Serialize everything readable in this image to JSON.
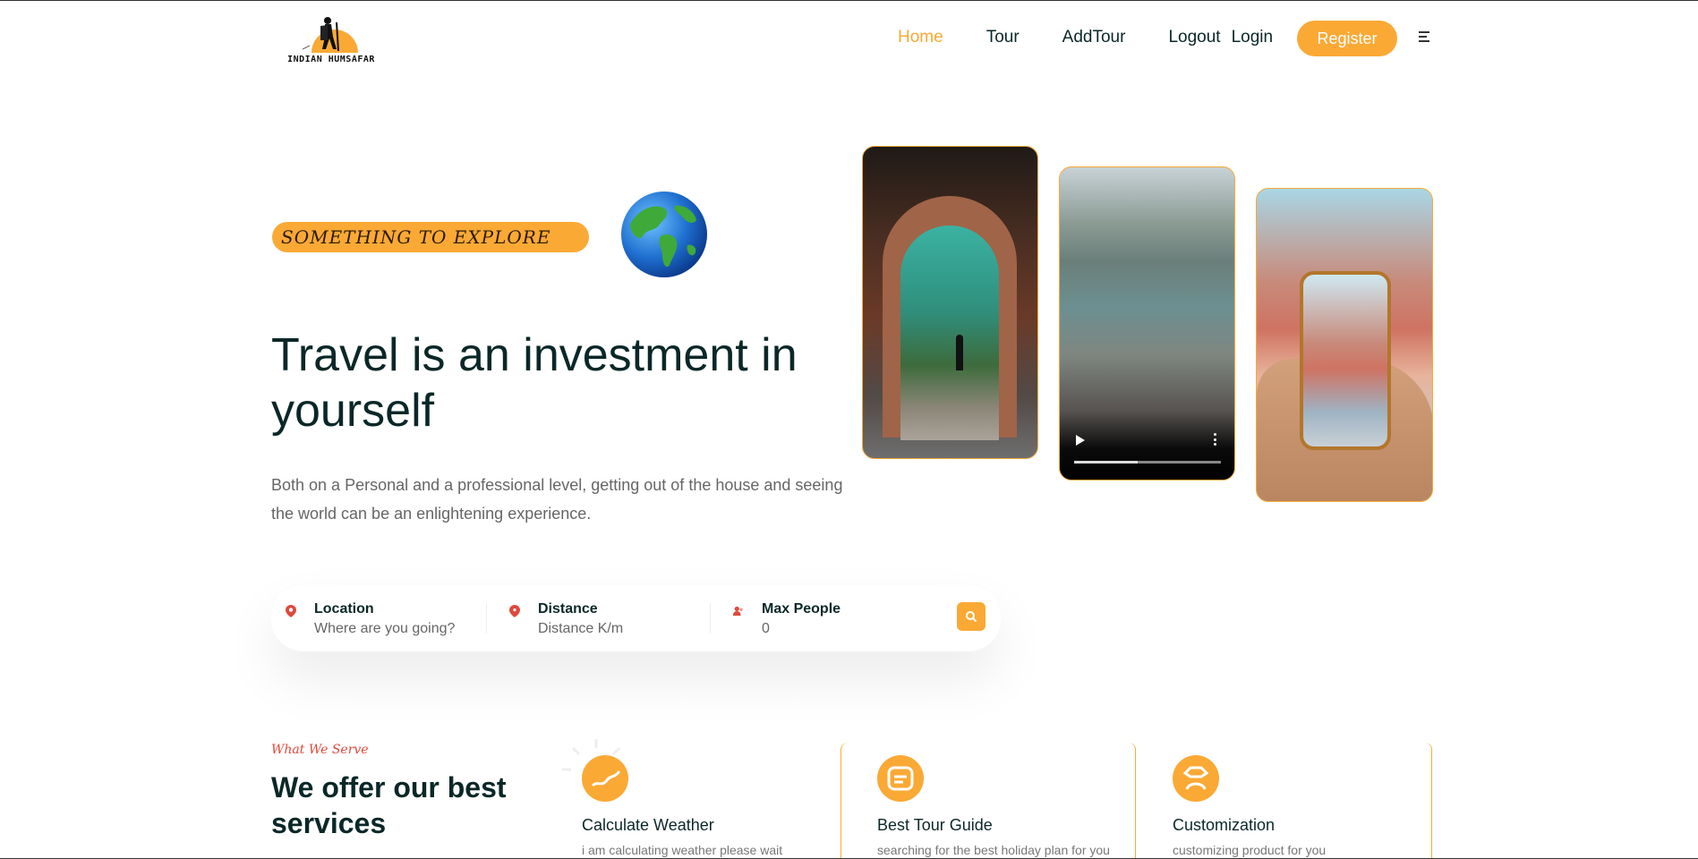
{
  "brand": {
    "logo_text": "INDIAN HUMSAFAR"
  },
  "nav": {
    "items": [
      "Home",
      "Tour",
      "AddTour",
      "Logout",
      "Login"
    ],
    "active": "Home",
    "register_label": "Register"
  },
  "hero": {
    "subtitle": "SOMETHING TO EXPLORE",
    "title": "Travel is an investment in yourself",
    "description": "Both on a Personal and a professional level, getting out of the house and seeing the world can be an enlightening experience."
  },
  "gallery": {
    "video_progress_percent": 43
  },
  "search": {
    "location": {
      "label": "Location",
      "placeholder": "Where are you going?"
    },
    "distance": {
      "label": "Distance",
      "placeholder": "Distance K/m"
    },
    "max_people": {
      "label": "Max People",
      "value": "0"
    }
  },
  "services": {
    "subtitle": "What We Serve",
    "title": "We offer our best services",
    "items": [
      {
        "title": "Calculate Weather",
        "desc": "i am calculating weather please wait"
      },
      {
        "title": "Best Tour Guide",
        "desc": "searching for the best holiday plan for you"
      },
      {
        "title": "Customization",
        "desc": "customizing product for you"
      }
    ]
  },
  "colors": {
    "accent": "#faa935",
    "heading": "#0b2727",
    "subtitle_red": "#e0483b"
  }
}
